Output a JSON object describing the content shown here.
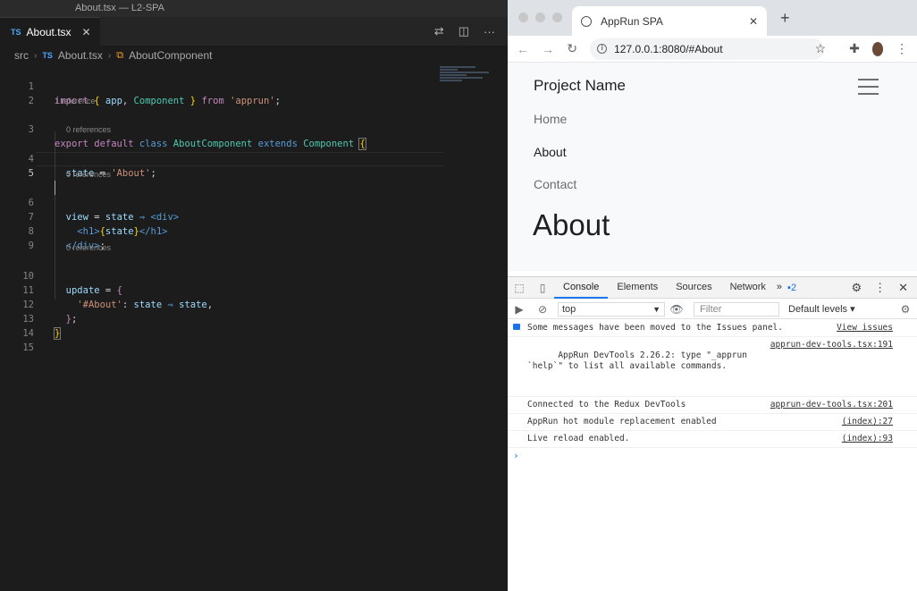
{
  "vscode": {
    "window_title": "About.tsx — L2-SPA",
    "tab": {
      "badge": "TS",
      "name": "About.tsx"
    },
    "breadcrumb": [
      "src",
      "About.tsx",
      "AboutComponent"
    ],
    "breadcrumb_badge": "TS",
    "lenses": {
      "class": "1 reference",
      "state": "0 references",
      "view": "0 references",
      "update": "0 references"
    },
    "line_numbers": [
      "1",
      "2",
      "3",
      "4",
      "5",
      "6",
      "7",
      "8",
      "9",
      "10",
      "11",
      "12",
      "13",
      "14",
      "15"
    ]
  },
  "browser": {
    "tab_title": "AppRun SPA",
    "url": "127.0.0.1:8080/#About",
    "page": {
      "brand": "Project Name",
      "nav_links": [
        "Home",
        "About",
        "Contact"
      ],
      "active_link": "About",
      "heading": "About"
    },
    "devtools": {
      "tabs": [
        "Console",
        "Elements",
        "Sources",
        "Network"
      ],
      "more": "»",
      "issues_count": "2",
      "context": "top",
      "filter_placeholder": "Filter",
      "levels": "Default levels ▾",
      "messages": [
        {
          "text": "Some messages have been moved to the Issues panel.",
          "source": "View issues",
          "icon": "info-icon"
        },
        {
          "text": "AppRun DevTools 2.26.2: type \"_apprun\n`help`\" to list all available commands.",
          "source": "apprun-dev-tools.tsx:191"
        },
        {
          "text": "Connected to the Redux DevTools",
          "source": "apprun-dev-tools.tsx:201"
        },
        {
          "text": "AppRun hot module replacement enabled",
          "source": "(index):27"
        },
        {
          "text": "Live reload enabled.",
          "source": "(index):93"
        }
      ],
      "prompt": "›"
    }
  },
  "colors": {
    "editor_bg": "#1c1c1c",
    "keyword": "#c586c0",
    "class_name": "#4ec9b0",
    "string": "#ce9178",
    "devtools_accent": "#1a73e8"
  }
}
